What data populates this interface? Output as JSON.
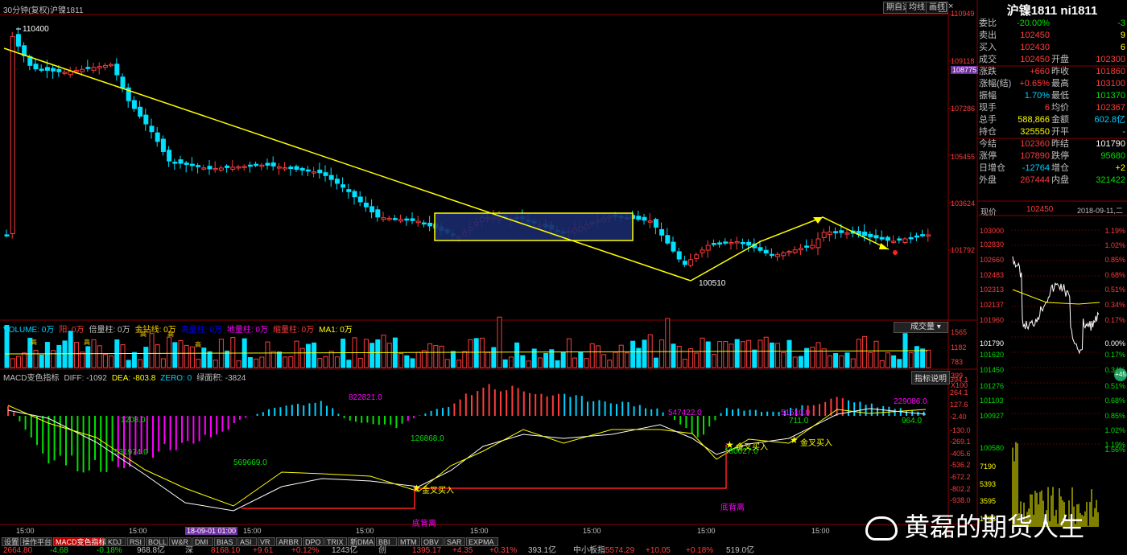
{
  "window": {
    "period_label": "30分钟(复权)",
    "symbol_label": "沪镍1811",
    "buttons": [
      "期自选",
      "均线",
      "画线"
    ],
    "corner_icons": [
      "settings-icon",
      "restore-icon",
      "close-icon"
    ]
  },
  "price_axis": {
    "labels": [
      "110949",
      "109118",
      "108775",
      "107286",
      "105455",
      "103624",
      "101792"
    ]
  },
  "main_chart": {
    "high_label": "110400",
    "low_label": "100510",
    "box_color": "#ffff00",
    "trend_color": "#ffff00"
  },
  "volume_panel": {
    "title_items": [
      {
        "text": "VOLUME: 0万",
        "color": "#00d0ff"
      },
      {
        "text": "阳: 0万",
        "color": "#ff3c3c"
      },
      {
        "text": "倍量柱: 0万",
        "color": "#c0c0c0"
      },
      {
        "text": "金钻线: 0万",
        "color": "#ffd000"
      },
      {
        "text": "高量柱: 0万",
        "color": "#0000ff"
      },
      {
        "text": "地量柱: 0万",
        "color": "#ff00ff"
      },
      {
        "text": "缩量柱: 0万",
        "color": "#ff3c3c"
      },
      {
        "text": "MA1: 0万",
        "color": "#ffff00"
      }
    ],
    "dropdown_label": "成交量",
    "axis_labels": [
      "1565",
      "1182",
      "783",
      "399",
      "X100"
    ],
    "high_marker": "高"
  },
  "macd_panel": {
    "title_items": [
      {
        "text": "MACD变色指标",
        "color": "#c0c0c0"
      },
      {
        "text": "DIFF: -1092",
        "color": "#c0c0c0"
      },
      {
        "text": "DEA: -803.8",
        "color": "#ffff00"
      },
      {
        "text": "ZERO: 0",
        "color": "#00d0ff"
      },
      {
        "text": "绿面积: -3824",
        "color": "#c0c0c0"
      }
    ],
    "help_label": "指标说明",
    "axis_labels": [
      "394.1",
      "264.1",
      "127.6",
      "-2.40",
      "-130.0",
      "-269.1",
      "-405.6",
      "-536.2",
      "-672.2",
      "-802.2",
      "-938.0"
    ],
    "annotations": [
      {
        "text": "822821.0",
        "color": "#ff00ff"
      },
      {
        "text": "1208.0",
        "color": "#00e000"
      },
      {
        "text": "531974.0",
        "color": "#00e000"
      },
      {
        "text": "569669.0",
        "color": "#00e000"
      },
      {
        "text": "126868.0",
        "color": "#00e000"
      },
      {
        "text": "547422.0",
        "color": "#ff00ff"
      },
      {
        "text": "51510.0",
        "color": "#ff00ff"
      },
      {
        "text": "711.0",
        "color": "#00e000"
      },
      {
        "text": "229086.0",
        "color": "#ff00ff"
      },
      {
        "text": "964.0",
        "color": "#00e000"
      },
      {
        "text": "180027.0",
        "color": "#00e000"
      }
    ],
    "cross_labels": [
      "金叉买入",
      "金叉买入",
      "金叉买入"
    ],
    "divergence_labels": [
      "底背离",
      "底背离"
    ]
  },
  "time_axis": {
    "labels": [
      "15:00",
      "15:00",
      "18-09-01 01:00",
      "15:00",
      "15:00",
      "15:00",
      "15:00",
      "15:00",
      "15:00"
    ]
  },
  "bottom_tabs": [
    "设置",
    "操作平台",
    "MACD变色指标",
    "KDJ",
    "RSI",
    "BOLL",
    "W&R",
    "DMI",
    "BIAS",
    "ASI",
    "VR",
    "ARBR",
    "DPO",
    "TRIX",
    "新DMA",
    "BBI",
    "MTM",
    "OBV",
    "SAR",
    "EXPMA"
  ],
  "statusbar": {
    "items": [
      {
        "text": "2664.80",
        "color": "#ff3c3c"
      },
      {
        "text": "-4.68",
        "color": "#00e000"
      },
      {
        "text": "-0.18%",
        "color": "#00e000"
      },
      {
        "text": "968.8亿",
        "color": "#c0c0c0"
      },
      {
        "text": "深",
        "color": "#c0c0c0"
      },
      {
        "text": "8168.10",
        "color": "#ff3c3c"
      },
      {
        "text": "+9.61",
        "color": "#ff3c3c"
      },
      {
        "text": "+0.12%",
        "color": "#ff3c3c"
      },
      {
        "text": "1243亿",
        "color": "#c0c0c0"
      },
      {
        "text": "创",
        "color": "#c0c0c0"
      },
      {
        "text": "1395.17",
        "color": "#ff3c3c"
      },
      {
        "text": "+4.35",
        "color": "#ff3c3c"
      },
      {
        "text": "+0.31%",
        "color": "#ff3c3c"
      },
      {
        "text": "393.1亿",
        "color": "#c0c0c0"
      },
      {
        "text": "中小板指",
        "color": "#c0c0c0"
      },
      {
        "text": "5574.29",
        "color": "#ff3c3c"
      },
      {
        "text": "+10.05",
        "color": "#ff3c3c"
      },
      {
        "text": "+0.18%",
        "color": "#ff3c3c"
      },
      {
        "text": "519.0亿",
        "color": "#c0c0c0"
      }
    ]
  },
  "quote_panel": {
    "title": "沪镍1811 ni1811",
    "rows": [
      {
        "l1": "委比",
        "v1": "-20.00%",
        "c1": "#00e000",
        "l2": "",
        "v2": "-3",
        "c2": "#00e000"
      },
      {
        "l1": "卖出",
        "v1": "102450",
        "c1": "#ff3c3c",
        "l2": "",
        "v2": "9",
        "c2": "#ffff00"
      },
      {
        "l1": "买入",
        "v1": "102430",
        "c1": "#ff3c3c",
        "l2": "",
        "v2": "6",
        "c2": "#ffff00"
      },
      {
        "l1": "成交",
        "v1": "102450",
        "c1": "#ff3c3c",
        "l2": "开盘",
        "v2": "102300",
        "c2": "#ff3c3c"
      },
      {
        "l1": "涨跌",
        "v1": "+660",
        "c1": "#ff3c3c",
        "l2": "昨收",
        "v2": "101860",
        "c2": "#ff3c3c"
      },
      {
        "l1": "涨幅(结)",
        "v1": "+0.65%",
        "c1": "#ff3c3c",
        "l2": "最高",
        "v2": "103100",
        "c2": "#ff3c3c"
      },
      {
        "l1": "振幅",
        "v1": "1.70%",
        "c1": "#00d0ff",
        "l2": "最低",
        "v2": "101370",
        "c2": "#00e000"
      },
      {
        "l1": "现手",
        "v1": "6",
        "c1": "#ff3c3c",
        "l2": "均价",
        "v2": "102367",
        "c2": "#ff3c3c"
      },
      {
        "l1": "总手",
        "v1": "588,866",
        "c1": "#ffff00",
        "l2": "金额",
        "v2": "602.8亿",
        "c2": "#00d0ff"
      },
      {
        "l1": "持仓",
        "v1": "325550",
        "c1": "#ffff00",
        "l2": "开平",
        "v2": "-",
        "c2": "#c0c0c0"
      },
      {
        "l1": "今结",
        "v1": "102360",
        "c1": "#ff3c3c",
        "l2": "昨结",
        "v2": "101790",
        "c2": "#ffffff"
      },
      {
        "l1": "涨停",
        "v1": "107890",
        "c1": "#ff3c3c",
        "l2": "跌停",
        "v2": "95680",
        "c2": "#00e000"
      },
      {
        "l1": "日增仓",
        "v1": "-12764",
        "c1": "#00d0ff",
        "l2": "增仓",
        "v2": "+2",
        "c2": "#ffff00"
      },
      {
        "l1": "外盘",
        "v1": "267444",
        "c1": "#ff3c3c",
        "l2": "内盘",
        "v2": "321422",
        "c2": "#00e000"
      }
    ],
    "price_now_label": "现价",
    "price_now_value": "102450",
    "date_label": "2018-09-11,二",
    "mini_left": [
      "103000",
      "102830",
      "102660",
      "102483",
      "102313",
      "102137",
      "101960",
      "101790",
      "101620",
      "101450",
      "101276",
      "101103",
      "100927",
      "100580",
      "7190",
      "5393",
      "3595",
      "1798"
    ],
    "mini_right": [
      "1.19%",
      "1.02%",
      "0.85%",
      "0.68%",
      "0.51%",
      "0.34%",
      "0.17%",
      "0.00%",
      "0.17%",
      "0.34%",
      "0.51%",
      "0.68%",
      "0.85%",
      "1.02%",
      "1.19%",
      "1.56%"
    ],
    "badge": "+45"
  },
  "watermark": "黄磊的期货人生"
}
